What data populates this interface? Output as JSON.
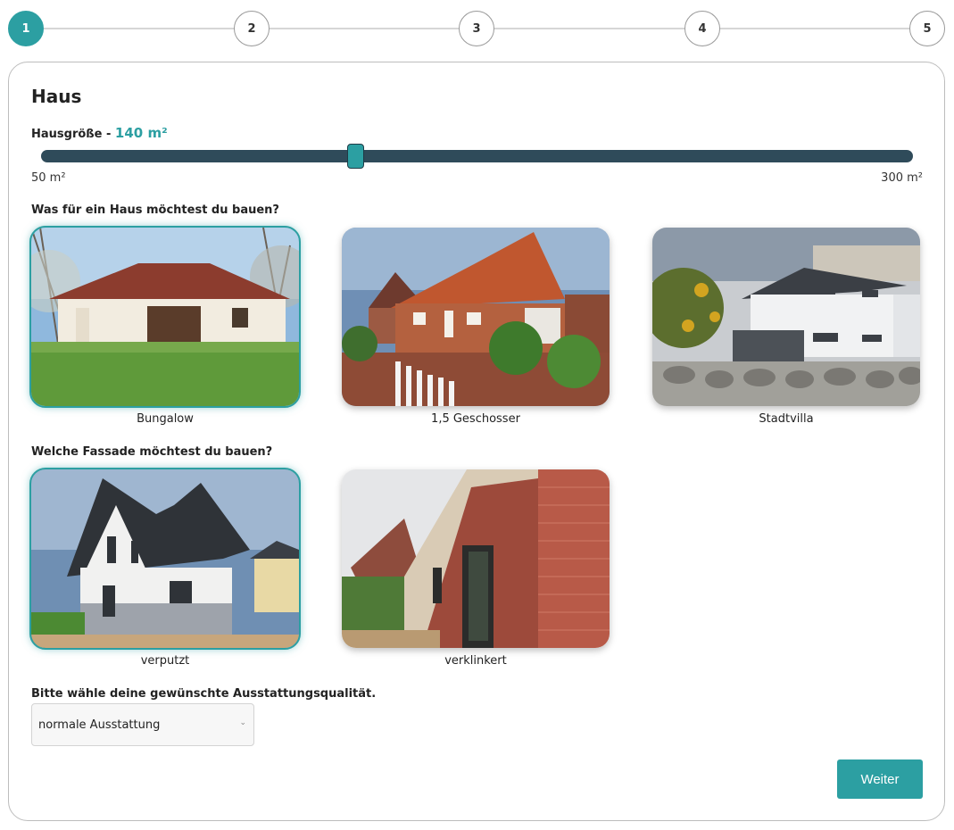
{
  "stepper": {
    "steps": [
      "1",
      "2",
      "3",
      "4",
      "5"
    ],
    "active_step": 1
  },
  "card": {
    "title": "Haus"
  },
  "size": {
    "label": "Hausgröße -",
    "value_text": "140 m²",
    "value": 140,
    "min": 50,
    "max": 300,
    "min_label": "50 m²",
    "max_label": "300 m²"
  },
  "house_type": {
    "question": "Was für ein Haus möchtest du bauen?",
    "selected": "Bungalow",
    "options": [
      {
        "label": "Bungalow",
        "image_icon": "bungalow-photo"
      },
      {
        "label": "1,5 Geschosser",
        "image_icon": "brick-house-photo"
      },
      {
        "label": "Stadtvilla",
        "image_icon": "city-villa-photo"
      }
    ]
  },
  "facade": {
    "question": "Welche Fassade möchtest du bauen?",
    "selected": "verputzt",
    "options": [
      {
        "label": "verputzt",
        "image_icon": "plastered-house-photo"
      },
      {
        "label": "verklinkert",
        "image_icon": "brick-facade-photo"
      }
    ]
  },
  "quality": {
    "question": "Bitte wähle deine gewünschte Ausstattungsqualität.",
    "selected_value": "normale Ausstattung"
  },
  "actions": {
    "next_label": "Weiter"
  },
  "colors": {
    "accent": "#2c9fa2",
    "slider_track": "#2f4b5a",
    "border": "#bdbdbd"
  }
}
